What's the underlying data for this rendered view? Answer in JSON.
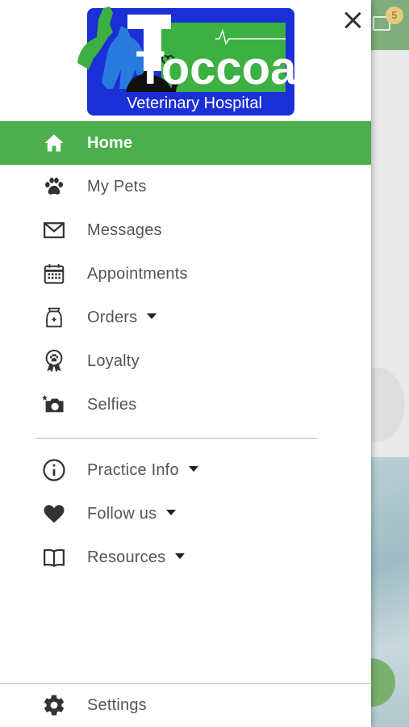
{
  "header": {
    "logo": {
      "name": "Toccoa",
      "subtitle": "Veterinary Hospital"
    }
  },
  "menu": {
    "items": [
      {
        "label": "Home",
        "icon": "home-icon",
        "active": true
      },
      {
        "label": "My Pets",
        "icon": "paw-icon"
      },
      {
        "label": "Messages",
        "icon": "mail-icon"
      },
      {
        "label": "Appointments",
        "icon": "calendar-icon"
      },
      {
        "label": "Orders",
        "icon": "medicine-bag-icon",
        "dropdown": true
      },
      {
        "label": "Loyalty",
        "icon": "award-ribbon-icon"
      },
      {
        "label": "Selfies",
        "icon": "camera-icon"
      }
    ],
    "secondary_items": [
      {
        "label": "Practice Info",
        "icon": "info-icon",
        "dropdown": true
      },
      {
        "label": "Follow us",
        "icon": "heart-icon",
        "dropdown": true
      },
      {
        "label": "Resources",
        "icon": "book-icon",
        "dropdown": true
      }
    ],
    "settings": {
      "label": "Settings",
      "icon": "gear-icon"
    }
  },
  "background": {
    "notification_count": "5"
  },
  "colors": {
    "accent": "#4cae4c",
    "logo_blue": "#1a2fd6",
    "logo_green": "#3cb043"
  }
}
